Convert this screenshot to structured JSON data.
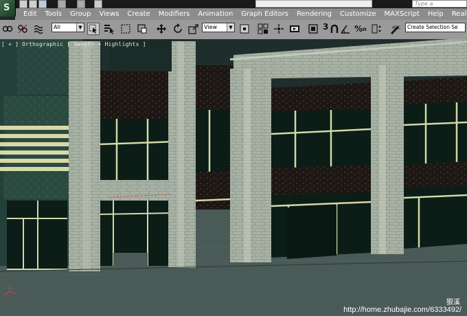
{
  "window": {
    "logo_glyph": "S",
    "type_box_placeholder": "Type a"
  },
  "menu": {
    "items": [
      "Edit",
      "Tools",
      "Group",
      "Views",
      "Create",
      "Modifiers",
      "Animation",
      "Graph Editors",
      "Rendering",
      "Customize",
      "MAXScript",
      "Help",
      "RealFlow"
    ]
  },
  "toolbar": {
    "selection_filter": "All",
    "reference_coord": "View",
    "named_selection": "Create Selection Se",
    "snap_value": "3",
    "icons": [
      "link-icon",
      "unlink-icon",
      "bind-spacewarp-icon",
      "select-object-icon",
      "select-by-name-icon",
      "rectangle-selection-icon",
      "window-crossing-icon",
      "move-icon",
      "rotate-icon",
      "scale-icon",
      "pivot-center-icon",
      "select-manipulate-icon",
      "keyboard-shortcut-icon",
      "snap-toggle-icon",
      "angle-snap-icon",
      "percent-snap-icon",
      "spinner-snap-icon",
      "edit-named-selections-icon"
    ]
  },
  "viewport": {
    "label": "[ + ] Orthographic [ Smooth + Highlights ]",
    "colors": {
      "ground": "#4a5a57",
      "sky": "#1f2e2c",
      "stone": "#a9b3a5",
      "glass": "#0c1c17",
      "mullion": "#d3d9a8",
      "dark_panel": "#1d1714"
    }
  },
  "watermark": {
    "name": "狠溪",
    "url": "http://home.zhubajie.com/6333492/"
  }
}
